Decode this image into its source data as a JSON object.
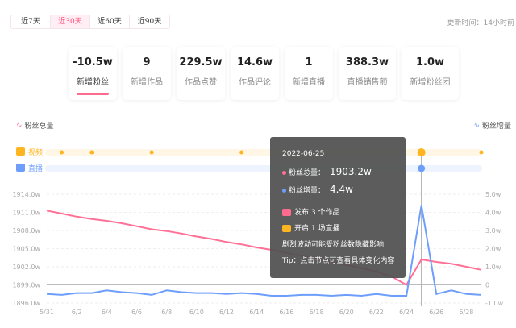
{
  "tabs": [
    {
      "label": "近7天"
    },
    {
      "label": "近30天",
      "active": true
    },
    {
      "label": "近60天"
    },
    {
      "label": "近90天"
    }
  ],
  "update_time": "更新时间：14小时前",
  "cards": [
    {
      "value": "-10.5w",
      "label": "新增粉丝",
      "active": true
    },
    {
      "value": "9",
      "label": "新增作品"
    },
    {
      "value": "229.5w",
      "label": "作品点赞"
    },
    {
      "value": "14.6w",
      "label": "作品评论"
    },
    {
      "value": "1",
      "label": "新增直播"
    },
    {
      "value": "388.3w",
      "label": "直播销售额"
    },
    {
      "value": "1.0w",
      "label": "新增粉丝团"
    }
  ],
  "colors": {
    "accent": "#ff4f7b",
    "total": "#ff7096",
    "increase": "#6e9efc",
    "video": "#ffb51f",
    "live": "#6e9efc"
  },
  "chart_data": {
    "type": "line",
    "legend": {
      "left": "粉丝总量",
      "right": "粉丝增量"
    },
    "event_rows": {
      "video_label": "视频",
      "live_label": "直播",
      "video_dates": [
        "6/1",
        "6/3",
        "6/7",
        "6/13",
        "6/25",
        "6/29"
      ],
      "live_dates": [
        "6/25"
      ],
      "highlight": "6/25"
    },
    "x": [
      "5/31",
      "6/1",
      "6/2",
      "6/3",
      "6/4",
      "6/5",
      "6/6",
      "6/7",
      "6/8",
      "6/9",
      "6/10",
      "6/11",
      "6/12",
      "6/13",
      "6/14",
      "6/15",
      "6/16",
      "6/17",
      "6/18",
      "6/19",
      "6/20",
      "6/21",
      "6/22",
      "6/23",
      "6/24",
      "6/25",
      "6/26",
      "6/27",
      "6/28",
      "6/29"
    ],
    "x_tick_labels": [
      "5/31",
      "6/2",
      "6/4",
      "6/6",
      "6/8",
      "6/10",
      "6/12",
      "6/14",
      "6/16",
      "6/18",
      "6/20",
      "6/22",
      "6/24",
      "6/26",
      "6/28"
    ],
    "y_left": {
      "ticks": [
        "1914.0w",
        "1911.0w",
        "1908.0w",
        "1905.0w",
        "1902.0w",
        "1899.0w",
        "1896.0w"
      ],
      "range": [
        1896,
        1914
      ]
    },
    "y_right": {
      "ticks": [
        "5.0w",
        "4.0w",
        "3.0w",
        "2.0w",
        "1.0w",
        "0",
        "-1.0w"
      ],
      "range": [
        -1,
        5
      ]
    },
    "series": [
      {
        "name": "粉丝总量",
        "axis": "left",
        "values": [
          1911.3,
          1910.8,
          1910.3,
          1909.9,
          1909.6,
          1909.2,
          1908.7,
          1908.2,
          1907.9,
          1907.5,
          1907.0,
          1906.6,
          1906.1,
          1905.7,
          1905.2,
          1904.8,
          1904.3,
          1903.8,
          1903.3,
          1902.8,
          1902.3,
          1901.8,
          1901.2,
          1900.4,
          1899.0,
          1903.2,
          1902.8,
          1902.5,
          1902.0,
          1901.5
        ]
      },
      {
        "name": "粉丝增量",
        "axis": "right",
        "values": [
          -0.5,
          -0.55,
          -0.45,
          -0.45,
          -0.3,
          -0.4,
          -0.45,
          -0.55,
          -0.3,
          -0.4,
          -0.45,
          -0.45,
          -0.5,
          -0.45,
          -0.5,
          -0.6,
          -0.6,
          -0.55,
          -0.55,
          -0.6,
          -0.55,
          -0.6,
          -0.5,
          -0.6,
          -0.6,
          4.4,
          -0.5,
          -0.3,
          -0.5,
          -0.55
        ]
      }
    ]
  },
  "tooltip": {
    "date": "2022-06-25",
    "total_label": "粉丝总量：",
    "total_value": "1903.2w",
    "inc_label": "粉丝增量：",
    "inc_value": "4.4w",
    "works": "发布 3 个作品",
    "live": "开启 1 场直播",
    "note": "剧烈波动可能受粉丝数隐藏影响",
    "tip": "Tip：点击节点可查看具体变化内容"
  }
}
